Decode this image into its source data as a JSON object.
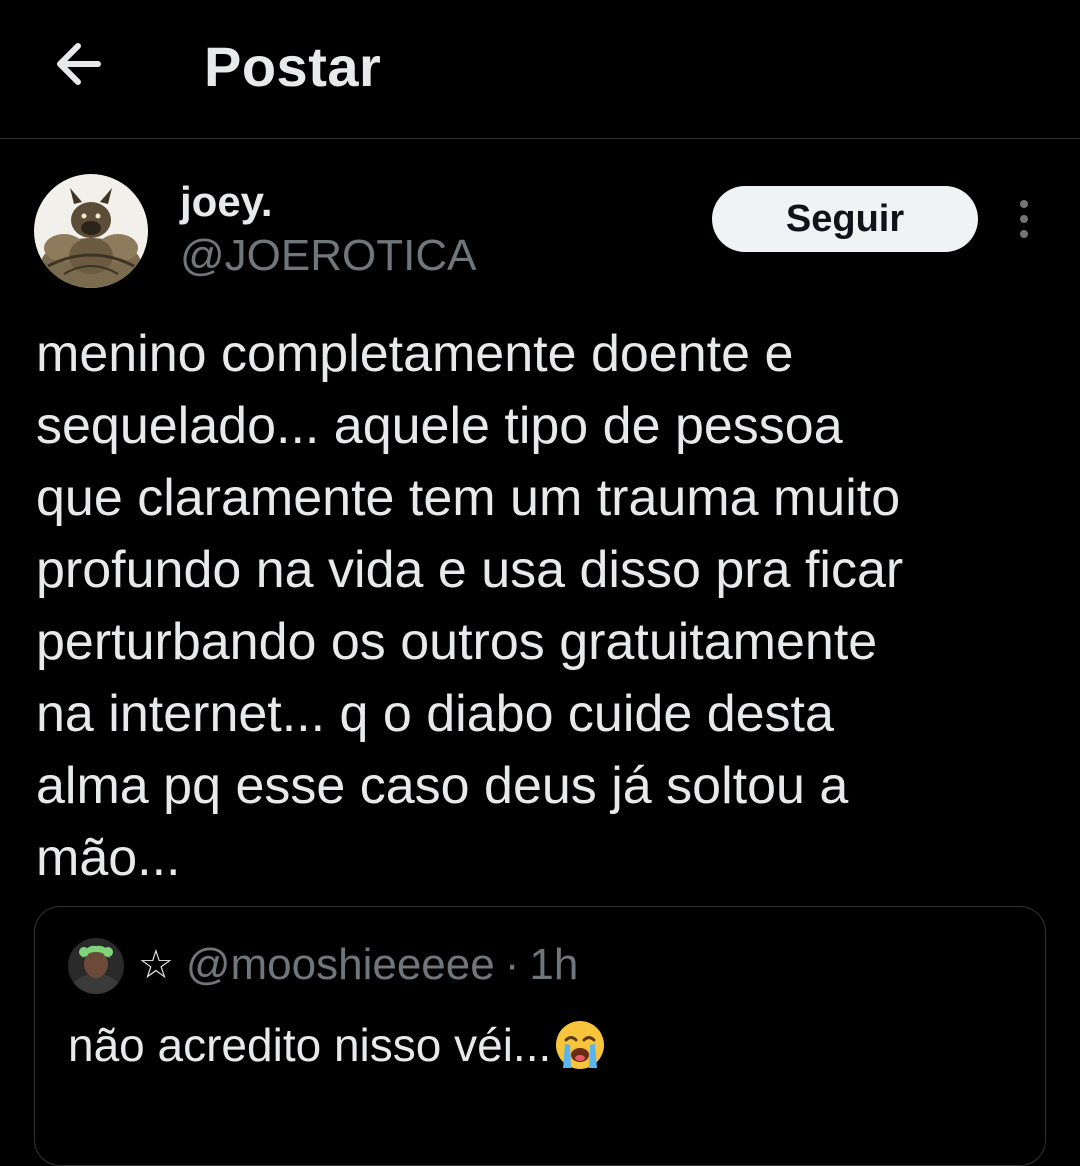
{
  "header": {
    "back_icon": "arrow-left-icon",
    "title": "Postar"
  },
  "post": {
    "author": {
      "display_name": "joey.",
      "handle": "@JOEROTICA",
      "avatar_icon": "avatar-muscular-dog"
    },
    "follow_label": "Seguir",
    "more_icon": "vertical-ellipsis-icon",
    "text": "menino completamente doente e\nsequelado... aquele tipo de pessoa\nque claramente tem um trauma muito\nprofundo na vida e usa disso pra ficar\nperturbando os outros gratuitamente\nna internet... q o diabo cuide desta\nalma pq esse caso deus já soltou a\nmão..."
  },
  "quote": {
    "avatar_icon": "avatar-green-hair",
    "star": "☆",
    "handle": "@mooshieeeee",
    "separator": "·",
    "time": "1h",
    "text": "não acredito nisso véi...",
    "emoji_icon": "loudly-crying-face-icon"
  },
  "colors": {
    "background": "#000000",
    "primary_text": "#e7e9ea",
    "secondary_text": "#71767b",
    "border": "#2f3336",
    "follow_button_bg": "#eff3f4",
    "follow_button_text": "#0f1419"
  }
}
